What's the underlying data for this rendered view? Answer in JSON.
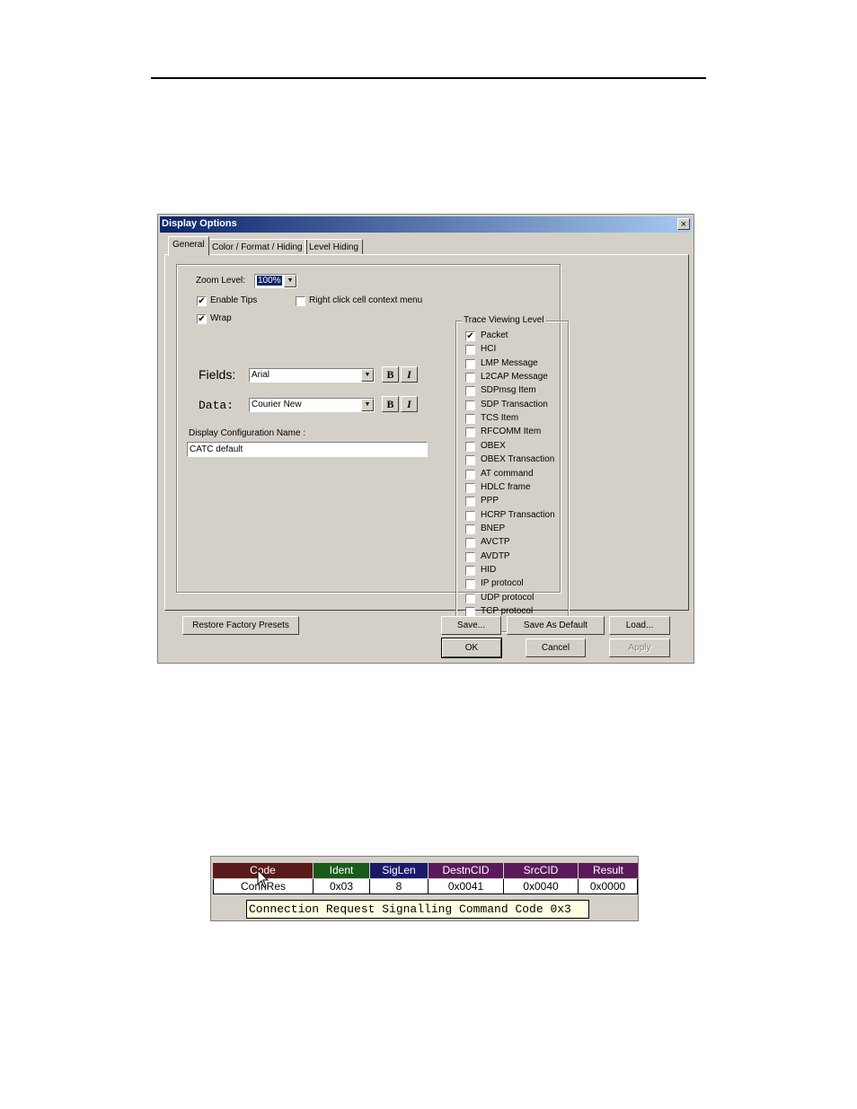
{
  "dialog": {
    "title": "Display Options",
    "close_glyph": "×",
    "tabs": [
      {
        "label": "General",
        "active": true
      },
      {
        "label": "Color / Format / Hiding",
        "active": false
      },
      {
        "label": "Level Hiding",
        "active": false
      }
    ],
    "general": {
      "zoom_label": "Zoom Level:",
      "zoom_value": "100%",
      "enable_tips": {
        "label": "Enable Tips",
        "checked": true
      },
      "wrap": {
        "label": "Wrap",
        "checked": true
      },
      "right_click": {
        "label": "Right click cell context menu",
        "checked": false
      },
      "fields_label": "Fields:",
      "fields_font": "Arial",
      "data_label": "Data:",
      "data_font": "Courier New",
      "bold_label": "B",
      "italic_label": "I",
      "config_name_label": "Display Configuration Name :",
      "config_name_value": "CATC default"
    },
    "trace_viewing_level": {
      "title": "Trace Viewing Level",
      "items": [
        {
          "label": "Packet",
          "checked": true
        },
        {
          "label": "HCI",
          "checked": false
        },
        {
          "label": "LMP Message",
          "checked": false
        },
        {
          "label": "L2CAP Message",
          "checked": false
        },
        {
          "label": "SDPmsg Item",
          "checked": false
        },
        {
          "label": "SDP Transaction",
          "checked": false
        },
        {
          "label": "TCS Item",
          "checked": false
        },
        {
          "label": "RFCOMM Item",
          "checked": false
        },
        {
          "label": "OBEX",
          "checked": false
        },
        {
          "label": "OBEX Transaction",
          "checked": false
        },
        {
          "label": "AT command",
          "checked": false
        },
        {
          "label": "HDLC frame",
          "checked": false
        },
        {
          "label": "PPP",
          "checked": false
        },
        {
          "label": "HCRP Transaction",
          "checked": false
        },
        {
          "label": "BNEP",
          "checked": false
        },
        {
          "label": "AVCTP",
          "checked": false
        },
        {
          "label": "AVDTP",
          "checked": false
        },
        {
          "label": "HID",
          "checked": false
        },
        {
          "label": "IP protocol",
          "checked": false
        },
        {
          "label": "UDP protocol",
          "checked": false
        },
        {
          "label": "TCP protocol",
          "checked": false
        }
      ]
    },
    "buttons": {
      "restore": "Restore Factory Presets",
      "save": "Save...",
      "save_default": "Save As Default",
      "load": "Load...",
      "ok": "OK",
      "cancel": "Cancel",
      "apply": "Apply"
    }
  },
  "packet_snippet": {
    "headers": [
      {
        "label": "Code",
        "color": "#5a1a1a"
      },
      {
        "label": "Ident",
        "color": "#1a5a1a"
      },
      {
        "label": "SigLen",
        "color": "#1a1a6a"
      },
      {
        "label": "DestnCID",
        "color": "#5a1a5a"
      },
      {
        "label": "SrcCID",
        "color": "#5a1a5a"
      },
      {
        "label": "Result",
        "color": "#5a1a5a"
      }
    ],
    "values": [
      "ConnRes",
      "0x03",
      "8",
      "0x0041",
      "0x0040",
      "0x0000"
    ],
    "tooltip": "Connection Request Signalling Command Code 0x3"
  }
}
